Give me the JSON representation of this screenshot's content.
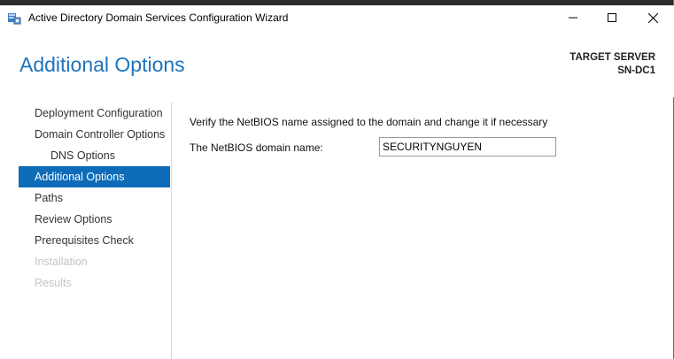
{
  "window": {
    "title": "Active Directory Domain Services Configuration Wizard",
    "controls": [
      "minimize",
      "maximize",
      "close"
    ]
  },
  "header": {
    "page_title": "Additional Options",
    "target_label": "TARGET SERVER",
    "target_name": "SN-DC1"
  },
  "nav": {
    "items": [
      {
        "label": "Deployment Configuration",
        "state": "normal"
      },
      {
        "label": "Domain Controller Options",
        "state": "normal"
      },
      {
        "label": "DNS Options",
        "state": "normal"
      },
      {
        "label": "Additional Options",
        "state": "active"
      },
      {
        "label": "Paths",
        "state": "normal"
      },
      {
        "label": "Review Options",
        "state": "normal"
      },
      {
        "label": "Prerequisites Check",
        "state": "normal"
      },
      {
        "label": "Installation",
        "state": "disabled"
      },
      {
        "label": "Results",
        "state": "disabled"
      }
    ]
  },
  "main": {
    "instruction": "Verify the NetBIOS name assigned to the domain and change it if necessary",
    "netbios_label": "The NetBIOS domain name:",
    "netbios_value": "SECURITYNGUYEN"
  },
  "colors": {
    "accent": "#1e73be",
    "nav_active": "#0d6bb8",
    "disabled_text": "#c4c4c4"
  }
}
